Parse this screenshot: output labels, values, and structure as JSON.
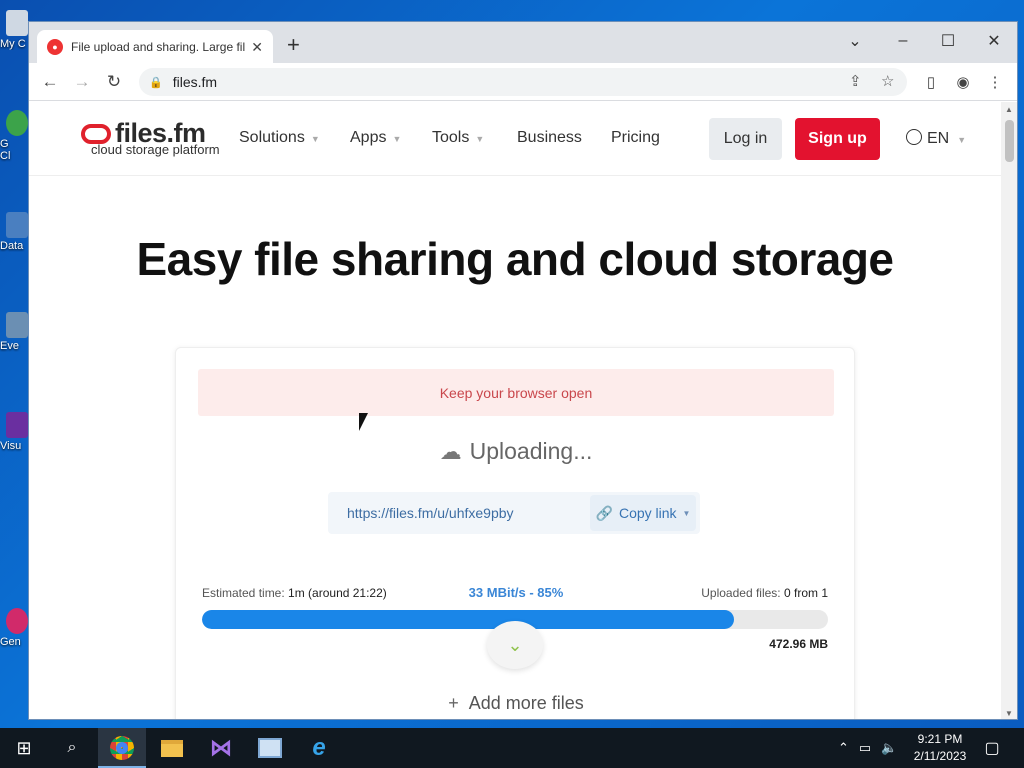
{
  "desktop": {
    "icons": [
      {
        "label": "My C"
      },
      {
        "label": "G"
      },
      {
        "label": "Cl"
      },
      {
        "label": "Data"
      },
      {
        "label": "Eve"
      },
      {
        "label": "Visu"
      },
      {
        "label": "Gen"
      }
    ]
  },
  "browser": {
    "tab_title": "File upload and sharing. Large fil",
    "url": "files.fm"
  },
  "site": {
    "logo_name": "files.fm",
    "logo_tagline": "cloud storage platform",
    "nav": [
      "Solutions",
      "Apps",
      "Tools",
      "Business",
      "Pricing"
    ],
    "login": "Log in",
    "signup": "Sign up",
    "lang": "EN",
    "hero_title": "Easy file sharing and cloud storage"
  },
  "upload": {
    "alert": "Keep your browser open",
    "status": "Uploading...",
    "share_link": "https://files.fm/u/uhfxe9pby",
    "copy_link": "Copy link",
    "eta_label": "Estimated time:",
    "eta_value": "1m (around 21:22)",
    "speed": "33 MBit/s - 85%",
    "progress_percent": 85,
    "uploaded_label": "Uploaded files:",
    "uploaded_value": "0 from 1",
    "size": "472.96 MB",
    "add_more": "Add more files",
    "progress_color": "#1a86e8"
  },
  "taskbar": {
    "time": "9:21 PM",
    "date": "2/11/2023"
  }
}
